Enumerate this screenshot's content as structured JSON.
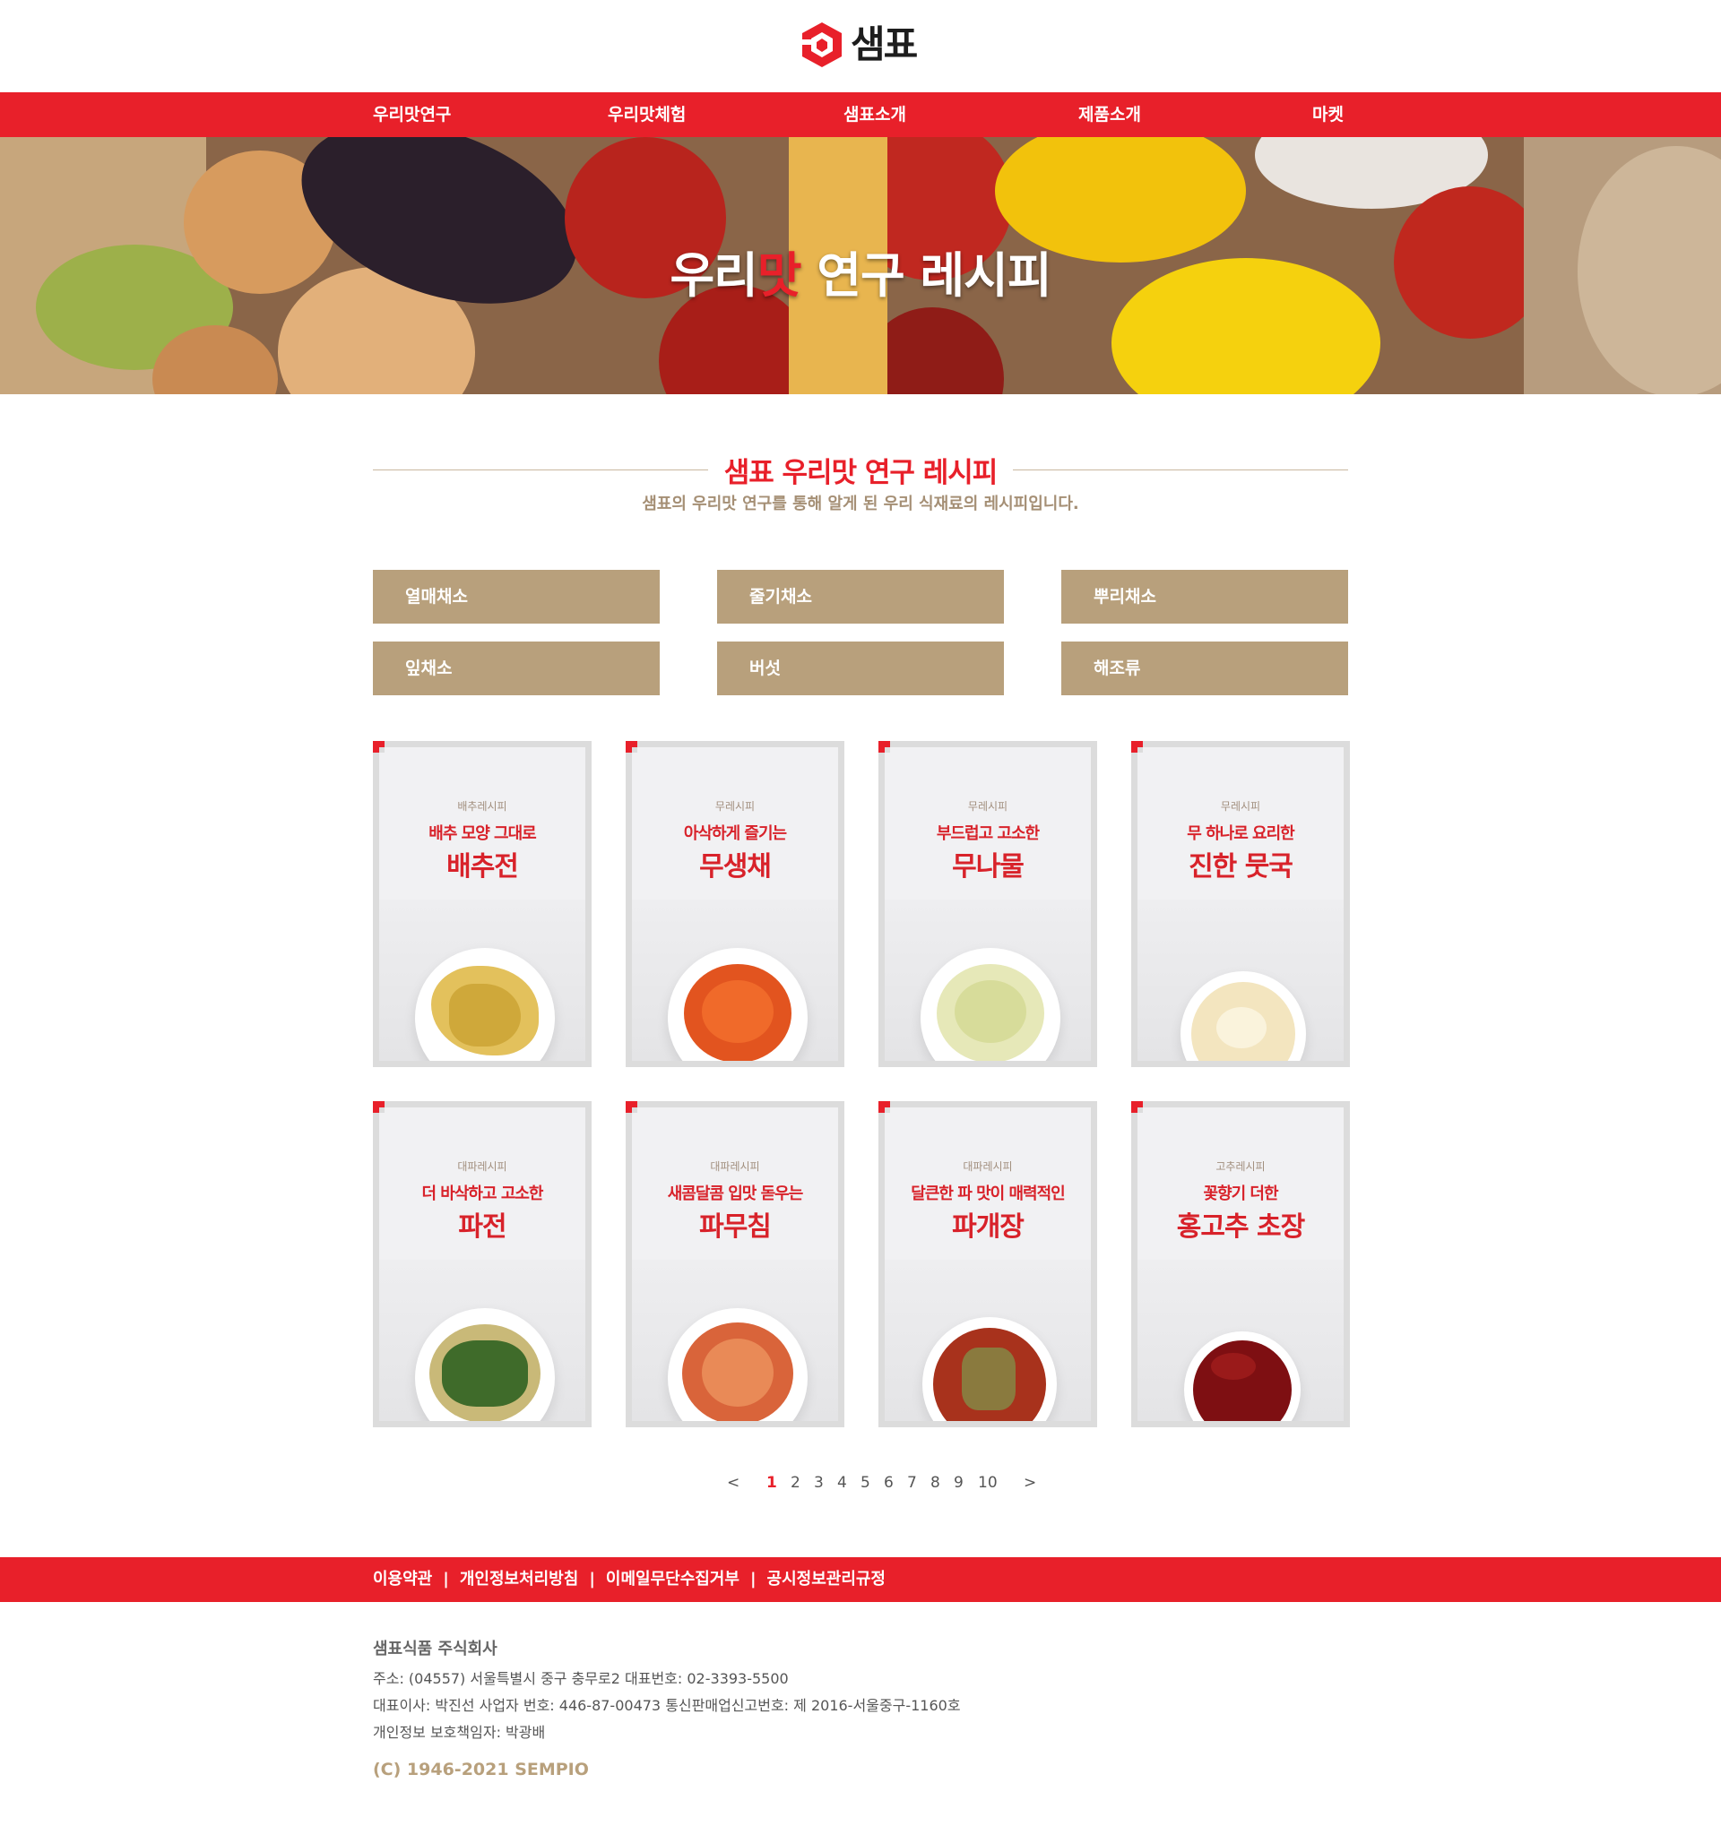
{
  "brand": {
    "name": "샘표",
    "color": "#e8202a"
  },
  "nav": [
    "우리맛연구",
    "우리맛체험",
    "샘표소개",
    "제품소개",
    "마켓"
  ],
  "hero": {
    "title_part1": "우리",
    "title_accent": "맛",
    "title_part2": " 연구 레시피"
  },
  "section": {
    "title": "샘표 우리맛 연구 레시피",
    "subtitle": "샘표의 우리맛 연구를 통해 알게 된 우리 식재료의 레시피입니다."
  },
  "categories": [
    "열매채소",
    "줄기채소",
    "뿌리채소",
    "잎채소",
    "버섯",
    "해조류"
  ],
  "recipes": [
    {
      "category": "배추레시피",
      "subtitle": "배추 모양 그대로",
      "name": "배추전"
    },
    {
      "category": "무레시피",
      "subtitle": "아삭하게 즐기는",
      "name": "무생채"
    },
    {
      "category": "무레시피",
      "subtitle": "부드럽고 고소한",
      "name": "무나물"
    },
    {
      "category": "무레시피",
      "subtitle": "무 하나로 요리한",
      "name": "진한 뭇국"
    },
    {
      "category": "대파레시피",
      "subtitle": "더 바삭하고 고소한",
      "name": "파전"
    },
    {
      "category": "대파레시피",
      "subtitle": "새콤달콤 입맛 돋우는",
      "name": "파무침"
    },
    {
      "category": "대파레시피",
      "subtitle": "달큰한 파 맛이 매력적인",
      "name": "파개장"
    },
    {
      "category": "고추레시피",
      "subtitle": "꽃향기 더한",
      "name": "홍고추 초장"
    }
  ],
  "pagination": {
    "prev": "<",
    "next": ">",
    "pages": [
      "1",
      "2",
      "3",
      "4",
      "5",
      "6",
      "7",
      "8",
      "9",
      "10"
    ],
    "current": "1"
  },
  "footer": {
    "links": [
      "이용약관",
      "개인정보처리방침",
      "이메일무단수집거부",
      "공시정보관리규정"
    ],
    "separator": "|",
    "company": "샘표식품 주식회사",
    "info": [
      "주소: (04557) 서울특별시 중구 충무로2   대표번호: 02-3393-5500",
      "대표이사: 박진선   사업자 번호: 446-87-00473   통신판매업신고번호: 제 2016-서울중구-1160호",
      "개인정보 보호책임자: 박광배"
    ],
    "copyright": "(C) 1946-2021 SEMPIO"
  }
}
